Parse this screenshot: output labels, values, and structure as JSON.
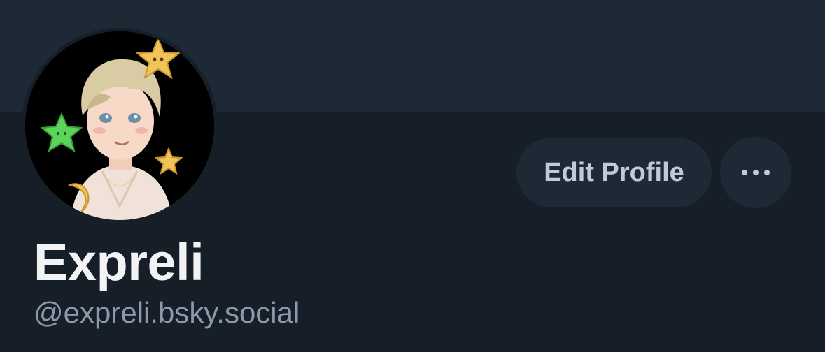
{
  "profile": {
    "display_name": "Expreli",
    "handle": "@expreli.bsky.social",
    "avatar_icon": "avatar-image"
  },
  "actions": {
    "edit_label": "Edit Profile",
    "more_icon": "ellipsis-icon"
  },
  "colors": {
    "background": "#161e27",
    "banner": "#1e2936",
    "button_bg": "#1e2936",
    "button_text": "#c1cad6",
    "name_text": "#f1f3f5",
    "handle_text": "#8c99aa"
  }
}
